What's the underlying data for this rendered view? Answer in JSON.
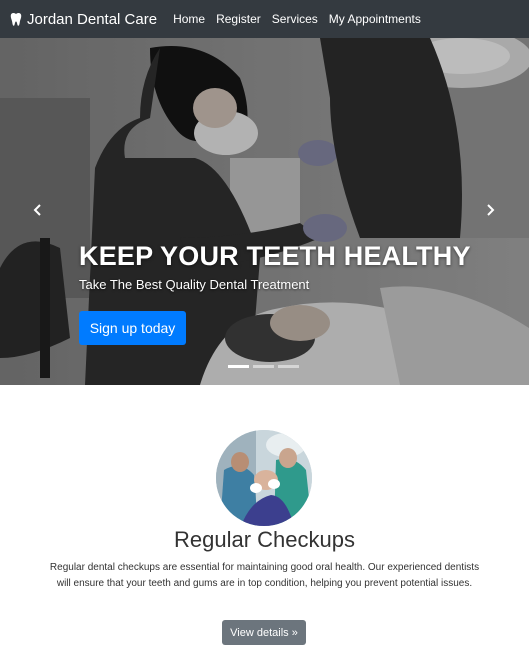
{
  "navbar": {
    "brand": "Jordan Dental Care",
    "brand_icon": "tooth-icon",
    "links": [
      {
        "label": "Home"
      },
      {
        "label": "Register"
      },
      {
        "label": "Services"
      },
      {
        "label": "My Appointments"
      }
    ]
  },
  "carousel": {
    "headline": "KEEP YOUR TEETH HEALTHY",
    "subheadline": "Take The Best Quality Dental Treatment",
    "cta_label": "Sign up today",
    "prev_icon": "chevron-left-icon",
    "next_icon": "chevron-right-icon",
    "slide_count": 3,
    "active_slide": 1
  },
  "service": {
    "title": "Regular Checkups",
    "description": "Regular dental checkups are essential for maintaining good oral health. Our experienced dentists will ensure that your teeth and gums are in top condition, helping you prevent potential issues.",
    "button_label": "View details »"
  },
  "colors": {
    "navbar_bg": "#343a40",
    "primary": "#007bff",
    "secondary": "#6c757d"
  }
}
